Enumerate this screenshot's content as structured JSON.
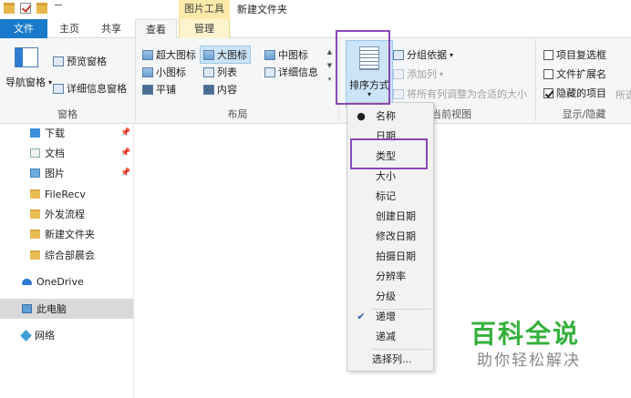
{
  "window": {
    "title": "新建文件夹",
    "context_header": "图片工具"
  },
  "tabs": [
    {
      "label": "文件"
    },
    {
      "label": "主页"
    },
    {
      "label": "共享"
    },
    {
      "label": "查看"
    },
    {
      "label": "管理"
    }
  ],
  "ribbon": {
    "panes": {
      "preview_pane": "预览窗格",
      "nav_pane": "导航窗格",
      "details_pane": "详细信息窗格",
      "group_label": "窗格"
    },
    "layout": {
      "items": [
        "超大图标",
        "大图标",
        "中图标",
        "小图标",
        "列表",
        "详细信息",
        "平铺",
        "内容"
      ],
      "group_label": "布局"
    },
    "current_view": {
      "sort_by": "排序方式",
      "group_by": "分组依据",
      "add_column": "添加列",
      "size_columns": "将所有列调整为合适的大小",
      "group_label": "当前视图"
    },
    "show_hide": {
      "item_checkboxes": "项目复选框",
      "file_extensions": "文件扩展名",
      "hidden_items": "隐藏的项目",
      "hide_selected": "所选",
      "group_label": "显示/隐藏"
    }
  },
  "nav_pane": {
    "items": [
      {
        "label": "下载",
        "pinned": true
      },
      {
        "label": "文档",
        "pinned": true
      },
      {
        "label": "图片",
        "pinned": true
      },
      {
        "label": "FileRecv"
      },
      {
        "label": "外发流程"
      },
      {
        "label": "新建文件夹"
      },
      {
        "label": "综合部晨会"
      },
      {
        "label": "OneDrive"
      },
      {
        "label": "此电脑"
      },
      {
        "label": "网络"
      }
    ],
    "pin_glyph": "📌"
  },
  "sort_menu": {
    "items": [
      {
        "label": "名称",
        "mark": "●"
      },
      {
        "label": "日期",
        "mark": ""
      },
      {
        "label": "类型",
        "mark": ""
      },
      {
        "label": "大小",
        "mark": ""
      },
      {
        "label": "标记",
        "mark": ""
      },
      {
        "label": "创建日期",
        "mark": ""
      },
      {
        "label": "修改日期",
        "mark": ""
      },
      {
        "label": "拍摄日期",
        "mark": ""
      },
      {
        "label": "分辨率",
        "mark": ""
      },
      {
        "label": "分级",
        "mark": ""
      },
      {
        "label": "递增",
        "mark": "✔"
      },
      {
        "label": "递减",
        "mark": ""
      },
      {
        "label": "选择列...",
        "mark": ""
      }
    ]
  },
  "watermark": {
    "title": "百科全说",
    "subtitle": "助你轻松解决"
  },
  "colors": {
    "file_tab": "#1979ca",
    "highlight_box": "#8a48b8",
    "selection": "#cce4f7",
    "watermark_green": "#35b03c"
  }
}
